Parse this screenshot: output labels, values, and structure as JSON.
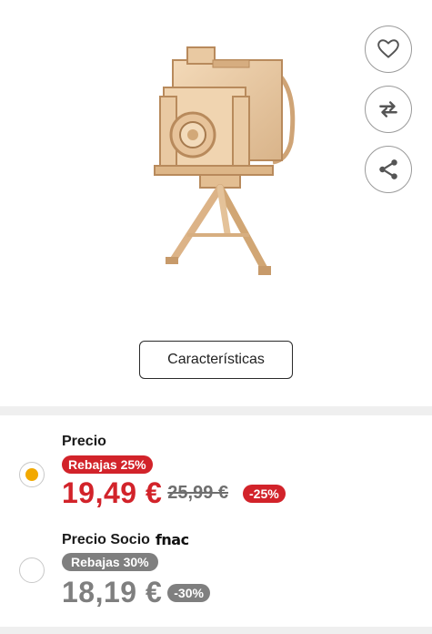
{
  "product": {
    "image_alt": "wooden vintage camera on tripod model kit"
  },
  "actions": {
    "favorite_icon": "heart-icon",
    "compare_icon": "swap-arrows-icon",
    "share_icon": "share-icon"
  },
  "features_button": {
    "label": "Características"
  },
  "price_options": [
    {
      "label": "Precio",
      "selected": true,
      "sale_badge": "Rebajas 25%",
      "price": "19,49 €",
      "old_price": "25,99 €",
      "discount": "-25%"
    },
    {
      "label": "Precio Socio",
      "brand_logo": "fnac",
      "selected": false,
      "sale_badge": "Rebajas 30%",
      "price": "18,19 €",
      "discount": "-30%"
    }
  ],
  "colors": {
    "sale_red": "#d2232a",
    "member_grey": "#7f7f7f",
    "radio_selected": "#f2a900"
  }
}
